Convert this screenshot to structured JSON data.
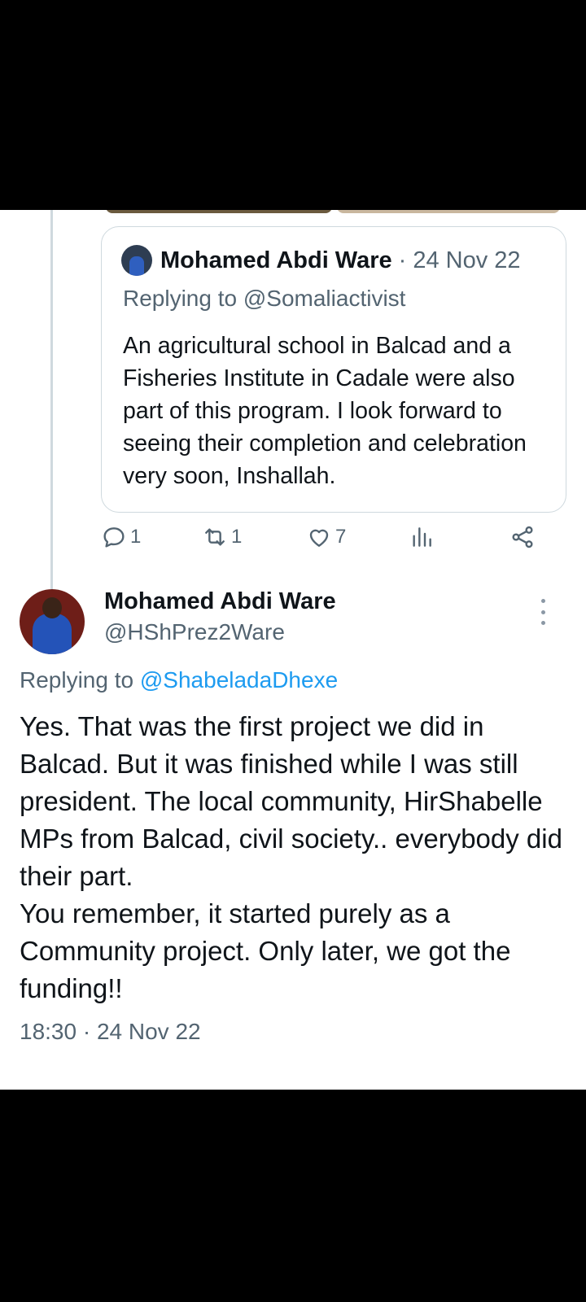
{
  "quoted_tweet": {
    "author_name": "Mohamed Abdi Ware",
    "separator": "·",
    "date": "24 Nov 22",
    "replying_to": "Replying to @Somaliactivist",
    "text": "An agricultural school in Balcad and a Fisheries Institute in Cadale were also part of this program. I look forward to seeing their completion and celebration very soon, Inshallah."
  },
  "actions": {
    "replies": "1",
    "retweets": "1",
    "likes": "7",
    "icons": [
      "reply-icon",
      "retweet-icon",
      "like-icon",
      "analytics-icon",
      "share-icon"
    ]
  },
  "main_tweet": {
    "author_name": "Mohamed Abdi Ware",
    "handle": "@HShPrez2Ware",
    "replying_prefix": "Replying to ",
    "replying_handle": "@ShabeladaDhexe",
    "text": "Yes. That was the first project we did  in Balcad. But it was finished while I was still president. The local community, HirShabelle MPs from Balcad, civil society.. everybody did their part.\nYou remember, it started purely as a Community project. Only later, we got the funding!!",
    "timestamp": "18:30 · 24 Nov 22"
  },
  "colors": {
    "accent": "#1d9bf0",
    "secondary_text": "#536471",
    "border": "#cfd9de"
  }
}
